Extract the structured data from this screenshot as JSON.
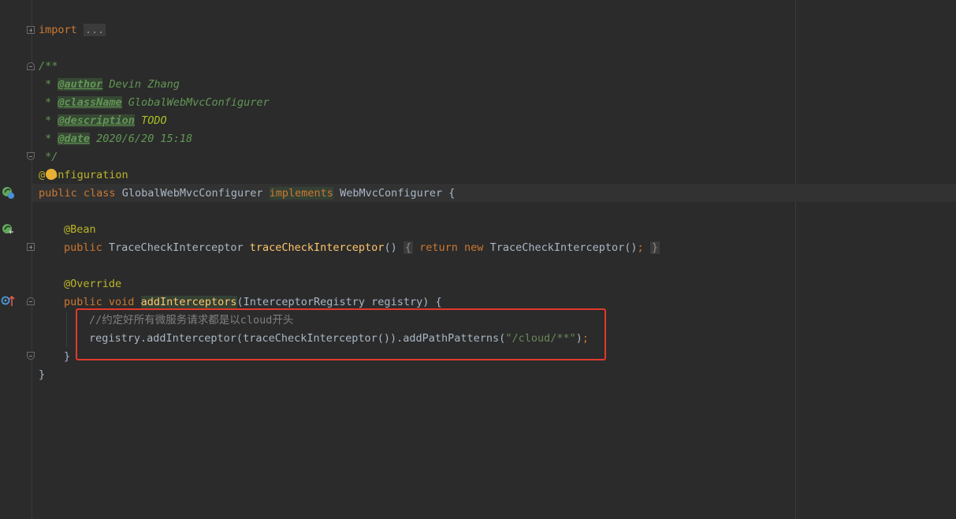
{
  "editor": {
    "lines": {
      "import_kw": "import",
      "import_fold": "...",
      "doc_open": "/**",
      "doc_star": " * ",
      "author_tag": "@author",
      "author_val": " Devin Zhang",
      "classname_tag": "@className",
      "classname_val": " GlobalWebMvcConfigurer",
      "description_tag": "@description",
      "description_val": " TODO",
      "date_tag": "@date",
      "date_val": " 2020/6/20 15:18",
      "doc_close": " */",
      "config_ann_a": "@",
      "config_ann_b": "onfiguration",
      "public_kw": "public",
      "class_kw": "class",
      "class_name": "GlobalWebMvcConfigurer",
      "implements_kw": "implements",
      "iface_name": "WebMvcConfigurer",
      "open_brace": "{",
      "bean_ann": "@Bean",
      "trace_type": "TraceCheckInterceptor",
      "trace_fn": "traceCheckInterceptor",
      "parens": "()",
      "fold_open": "{",
      "return_kw": "return",
      "new_kw": "new",
      "trace_ctor": "TraceCheckInterceptor",
      "ctor_tail": "()",
      "semi": ";",
      "fold_close": "}",
      "override_ann": "@Override",
      "void_kw": "void",
      "add_fn": "addInterceptors",
      "params": "(InterceptorRegistry registry) {",
      "comment": "//约定好所有微服务请求都是以cloud开头",
      "registry_call": "registry.addInterceptor(traceCheckInterceptor()).addPathPatterns(",
      "path_str": "\"/cloud/**\"",
      "call_end": ")",
      "close_method": "}",
      "close_class": "}"
    }
  }
}
